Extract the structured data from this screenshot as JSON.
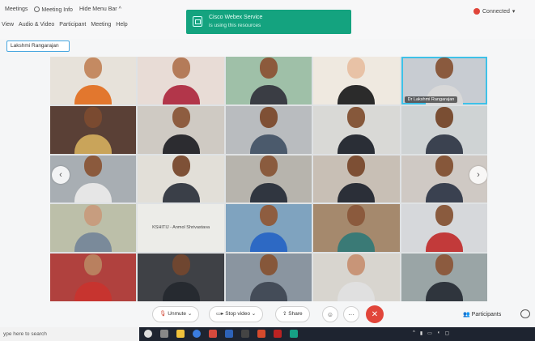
{
  "menu": {
    "top": [
      "Meetings",
      "Meeting Info",
      "Hide Menu Bar ^"
    ],
    "bar": [
      "View",
      "Audio & Video",
      "Participant",
      "Meeting",
      "Help"
    ]
  },
  "banner": {
    "line1": "Cisco Webex Service",
    "line2": "is using this resources"
  },
  "status": {
    "connected": "Connected"
  },
  "name_tag": "Lakshmi Rangarajan",
  "tiles": [
    {
      "label": ""
    },
    {
      "label": ""
    },
    {
      "label": ""
    },
    {
      "label": ""
    },
    {
      "label": "Dr Lakshmi Rangarajan"
    },
    {
      "label": ""
    },
    {
      "label": ""
    },
    {
      "label": ""
    },
    {
      "label": ""
    },
    {
      "label": ""
    },
    {
      "label": ""
    },
    {
      "label": ""
    },
    {
      "label": ""
    },
    {
      "label": ""
    },
    {
      "label": ""
    },
    {
      "label": ""
    },
    {
      "label": "KSHITIJ - Anmol Shrivastava"
    },
    {
      "label": ""
    },
    {
      "label": ""
    },
    {
      "label": ""
    },
    {
      "label": ""
    },
    {
      "label": ""
    },
    {
      "label": ""
    },
    {
      "label": ""
    },
    {
      "label": ""
    }
  ],
  "controls": {
    "unmute": "Unmute",
    "stop_video": "Stop video",
    "share": "Share",
    "participants": "Participants"
  },
  "taskbar": {
    "search_placeholder": "ype here to search"
  },
  "colors": {
    "accent": "#3ec1e8",
    "banner": "#14a37f",
    "end_call": "#e1453a"
  }
}
